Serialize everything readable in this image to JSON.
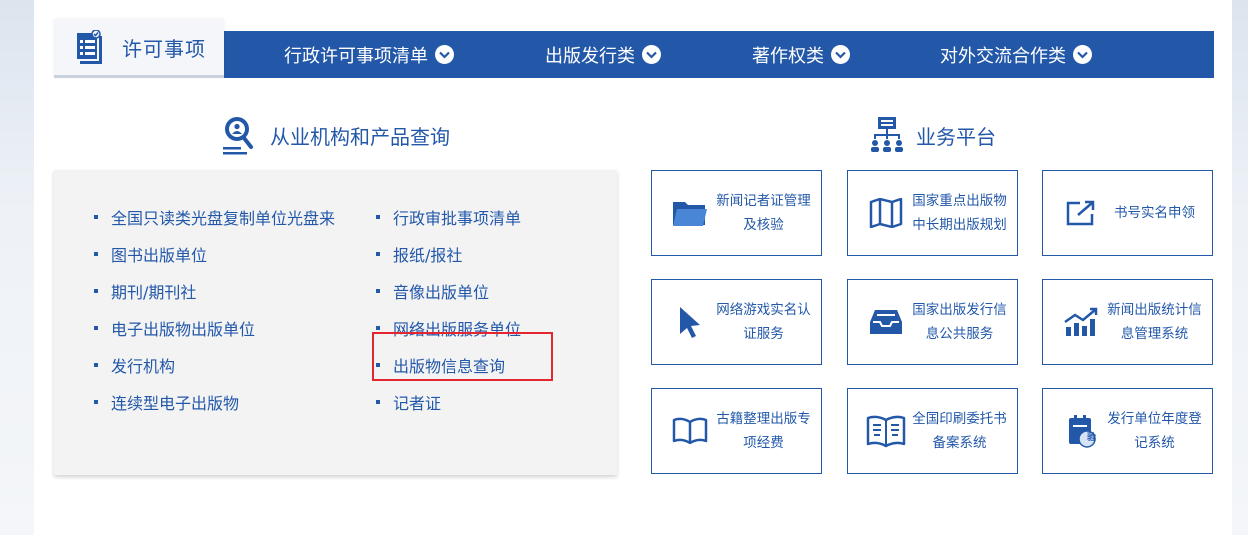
{
  "nav": {
    "active_tab": "许可事项",
    "items": [
      "行政许可事项清单",
      "出版发行类",
      "著作权类",
      "对外交流合作类"
    ]
  },
  "left_section": {
    "title": "从业机构和产品查询",
    "col1": [
      "全国只读类光盘复制单位光盘来",
      "图书出版单位",
      "期刊/期刊社",
      "电子出版物出版单位",
      "发行机构",
      "连续型电子出版物"
    ],
    "col2": [
      "行政审批事项清单",
      "报纸/报社",
      "音像出版单位",
      "网络出版服务单位",
      "出版物信息查询",
      "记者证"
    ]
  },
  "right_section": {
    "title": "业务平台",
    "tiles": [
      {
        "label": "新闻记者证管理及核验",
        "icon": "folder-icon"
      },
      {
        "label": "国家重点出版物中长期出版规划",
        "icon": "book-map-icon"
      },
      {
        "label": "书号实名申领",
        "icon": "external-link-icon"
      },
      {
        "label": "网络游戏实名认证服务",
        "icon": "cursor-icon"
      },
      {
        "label": "国家出版发行信息公共服务",
        "icon": "inbox-icon"
      },
      {
        "label": "新闻出版统计信息管理系统",
        "icon": "chart-icon"
      },
      {
        "label": "古籍整理出版专项经费",
        "icon": "open-book-icon"
      },
      {
        "label": "全国印刷委托书备案系统",
        "icon": "print-book-icon"
      },
      {
        "label": "发行单位年度登记系统",
        "icon": "calendar-verify-icon"
      }
    ],
    "tile_badge": "验"
  },
  "colors": {
    "primary": "#2358a9",
    "highlight": "#e3262f",
    "panel": "#f3f3f4"
  }
}
